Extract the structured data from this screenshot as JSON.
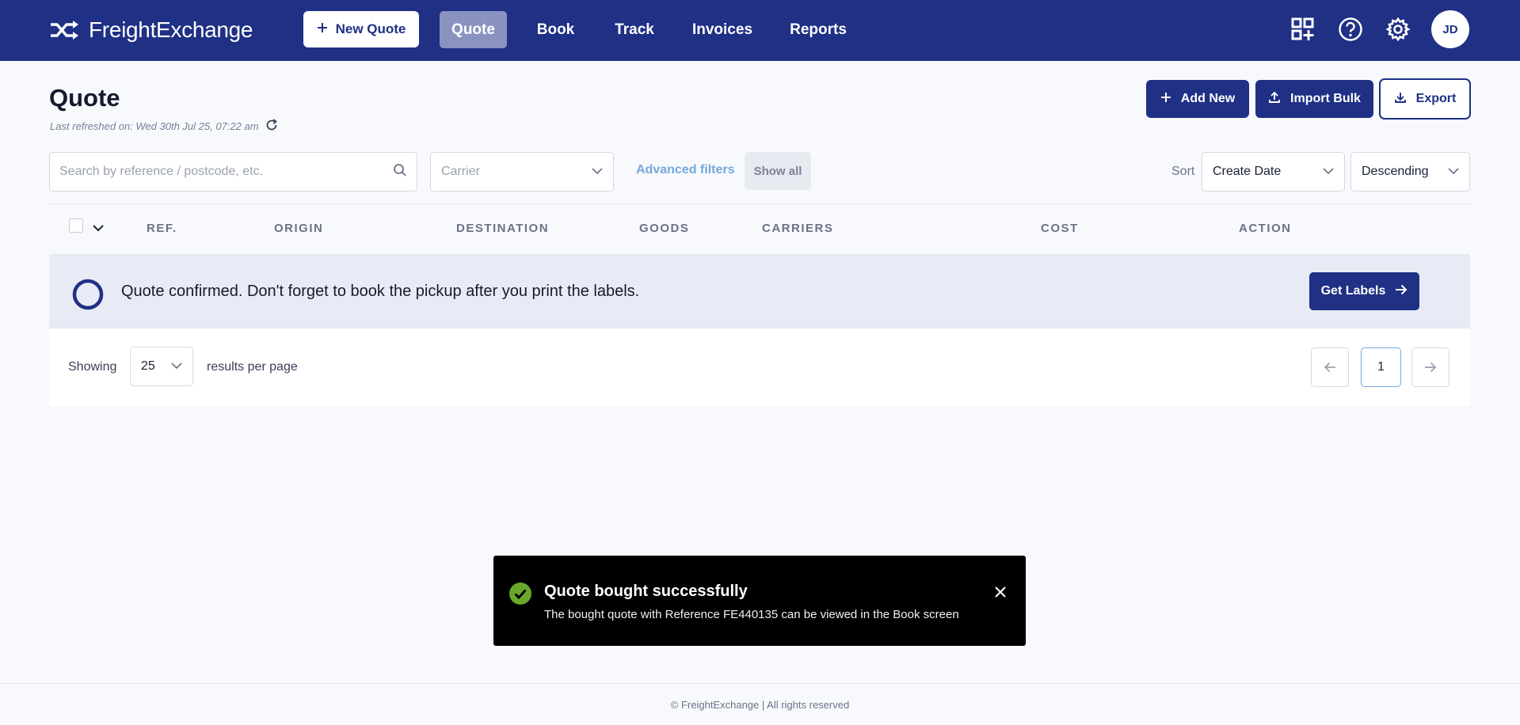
{
  "app": {
    "brand_name": "FreightExchange",
    "brand_logo_icon": "shuffle-arrows-icon",
    "accent_color": "#1f3085"
  },
  "nav": {
    "new_quote_label": "New Quote",
    "tabs": [
      {
        "label": "Quote",
        "active": true
      },
      {
        "label": "Book",
        "active": false
      },
      {
        "label": "Track",
        "active": false
      },
      {
        "label": "Invoices",
        "active": false
      },
      {
        "label": "Reports",
        "active": false
      }
    ],
    "icons": [
      "apps-add-icon",
      "help-icon",
      "gear-icon"
    ],
    "avatar_initials": "JD"
  },
  "header": {
    "title": "Quote",
    "last_refreshed": "Last refreshed on: Wed 30th Jul 25, 07:22 am",
    "add_new_label": "Add New",
    "import_bulk_label": "Import Bulk",
    "export_label": "Export"
  },
  "filters": {
    "search_placeholder": "Search by reference / postcode, etc.",
    "carrier_placeholder": "Carrier",
    "advanced_filters_label": "Advanced filters",
    "show_all_label": "Show all",
    "sort_label": "Sort",
    "sort_field": "Create Date",
    "sort_order": "Descending"
  },
  "table": {
    "columns": [
      "REF.",
      "ORIGIN",
      "DESTINATION",
      "GOODS",
      "CARRIERS",
      "COST",
      "ACTION"
    ],
    "notice": "Quote confirmed. Don't forget to book the pickup after you print the labels.",
    "get_labels_label": "Get Labels"
  },
  "pagination": {
    "showing_label": "Showing",
    "per_page": "25",
    "results_label": "results per page",
    "current_page": "1"
  },
  "toast": {
    "title": "Quote bought successfully",
    "message": "The bought quote with Reference FE440135 can be viewed in the Book screen",
    "success_color": "#6aa82c"
  },
  "footer": {
    "text": "© FreightExchange | All rights reserved"
  }
}
